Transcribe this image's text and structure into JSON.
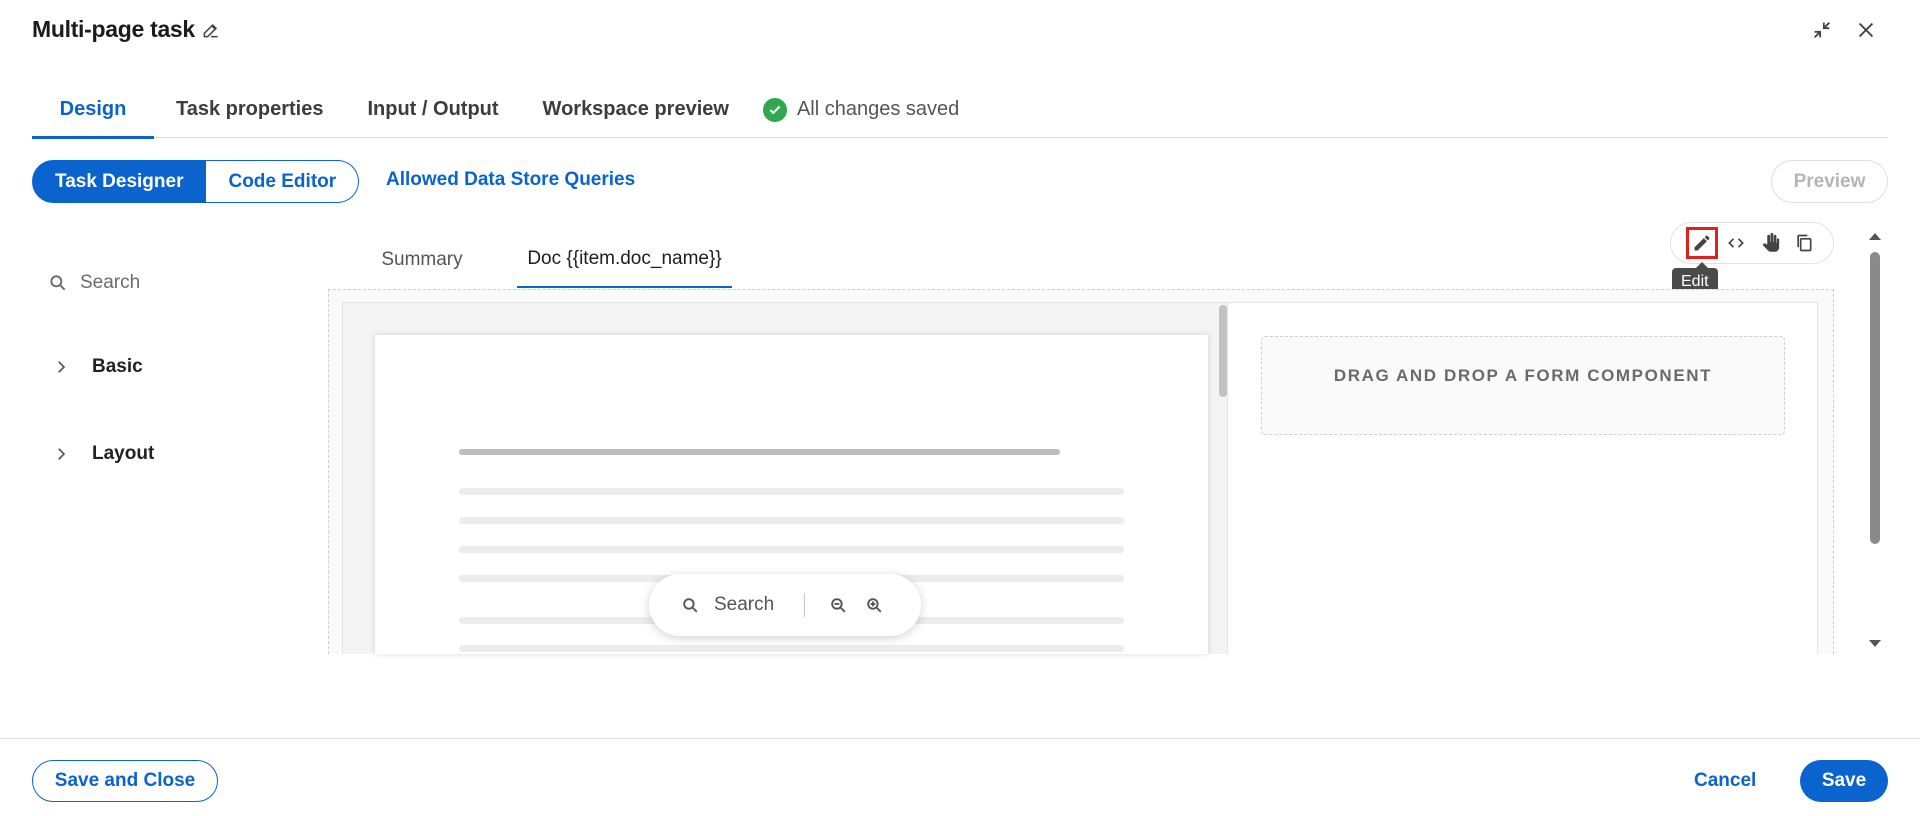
{
  "header": {
    "title": "Multi-page task"
  },
  "tabs": [
    {
      "label": "Design"
    },
    {
      "label": "Task properties"
    },
    {
      "label": "Input / Output"
    },
    {
      "label": "Workspace preview"
    }
  ],
  "status": {
    "text": "All changes saved"
  },
  "mode": {
    "task_designer": "Task Designer",
    "code_editor": "Code Editor",
    "allowed_queries": "Allowed Data Store Queries",
    "preview": "Preview"
  },
  "palette": {
    "search_placeholder": "Search",
    "groups": [
      {
        "label": "Basic"
      },
      {
        "label": "Layout"
      }
    ]
  },
  "canvas_tabs": [
    {
      "label": "Summary"
    },
    {
      "label": "Doc {{item.doc_name}}"
    }
  ],
  "toolbar": {
    "tooltip": "Edit",
    "icons": [
      "pencil-icon",
      "code-icon",
      "hand-icon",
      "copy-icon"
    ]
  },
  "document": {
    "search_placeholder": "Search"
  },
  "dropzone": {
    "text": "DRAG AND DROP A FORM COMPONENT"
  },
  "footer": {
    "save_close": "Save and Close",
    "cancel": "Cancel",
    "save": "Save"
  },
  "colors": {
    "accent": "#0b63ce",
    "success": "#2fa84f",
    "highlight": "#e01f1f"
  }
}
